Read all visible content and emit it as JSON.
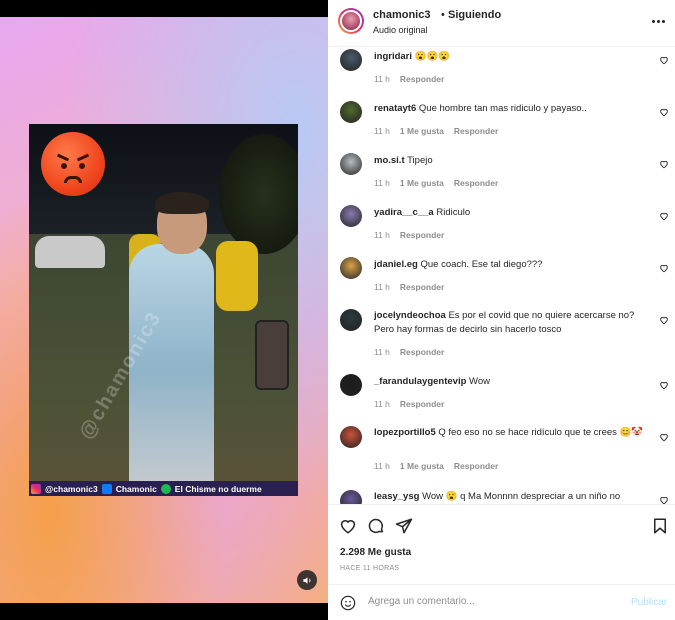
{
  "post": {
    "username": "chamonic3",
    "separator": "•",
    "follow_label": "Siguiendo",
    "audio": "Audio original",
    "likes": "2.298 Me gusta",
    "time_ago": "HACE 11 HORAS"
  },
  "video": {
    "credits": [
      "@chamonic3",
      "Chamonic",
      "El Chisme no duerme"
    ],
    "watermark": "@chamonic3"
  },
  "comments": [
    {
      "user": "ingridari",
      "text": "😮😮😮",
      "time": "11 h",
      "likes": "",
      "reply": "Responder",
      "avatar": "#4a5a6a"
    },
    {
      "user": "renatayt6",
      "text": "Que hombre tan mas ridiculo y payaso..",
      "time": "11 h",
      "likes": "1 Me gusta",
      "reply": "Responder",
      "avatar": "#4f6a2d"
    },
    {
      "user": "mo.si.t",
      "text": "Tipejo",
      "time": "11 h",
      "likes": "1 Me gusta",
      "reply": "Responder",
      "avatar": "#b9bcc0"
    },
    {
      "user": "yadira__c__a",
      "text": "Ridiculo",
      "time": "11 h",
      "likes": "",
      "reply": "Responder",
      "avatar": "#8a7ab0"
    },
    {
      "user": "jdaniel.eg",
      "text": "Que coach. Ese tal diego???",
      "time": "11 h",
      "likes": "",
      "reply": "Responder",
      "avatar": "#d9a24a"
    },
    {
      "user": "jocelyndeochoa",
      "text": "Es por el covid que no quiere acercarse no? Pero hay formas de decirlo sin hacerlo tosco",
      "time": "11 h",
      "likes": "",
      "reply": "Responder",
      "avatar": "#2c3a3e"
    },
    {
      "user": "_farandulaygentevip",
      "text": "Wow",
      "time": "11 h",
      "likes": "",
      "reply": "Responder",
      "avatar": "#1c1c1c"
    },
    {
      "user": "lopezportillo5",
      "text": "Q feo eso no se hace ridículo que te crees 😊🤡",
      "time": "11 h",
      "likes": "1 Me gusta",
      "reply": "Responder",
      "avatar": "#c9523c"
    },
    {
      "user": "leasy_ysg",
      "text": "Wow 😮 q Ma Monnnn despreciar a un niño no",
      "time": "",
      "likes": "",
      "reply": "",
      "avatar": "#6a5a9a"
    }
  ],
  "composer": {
    "placeholder": "Agrega un comentario...",
    "post_label": "Publicar"
  },
  "colors": {
    "link": "#0095f6",
    "muted": "#8e8e8e",
    "text": "#262626"
  }
}
